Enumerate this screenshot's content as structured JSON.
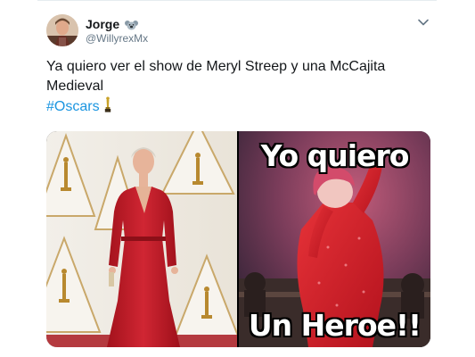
{
  "tweet": {
    "author_name": "Jorge",
    "author_name_emoji": "koala-icon",
    "author_handle": "@WillyrexMx",
    "text_line1": "Ya quiero ver el show de Meryl Streep y una McCajita",
    "text_line2": "Medieval",
    "hashtag": "#Oscars",
    "hashtag_emoji": "oscar-statue-icon",
    "menu_icon": "chevron-down-icon",
    "link_color": "#1b95e0"
  },
  "media": {
    "left_image": "photo-woman-red-dress-oscars",
    "right_image": "meme-animated-singer-red-dress",
    "meme_top_text": "Yo quiero",
    "meme_bottom_text": "Un Heroe!!"
  }
}
